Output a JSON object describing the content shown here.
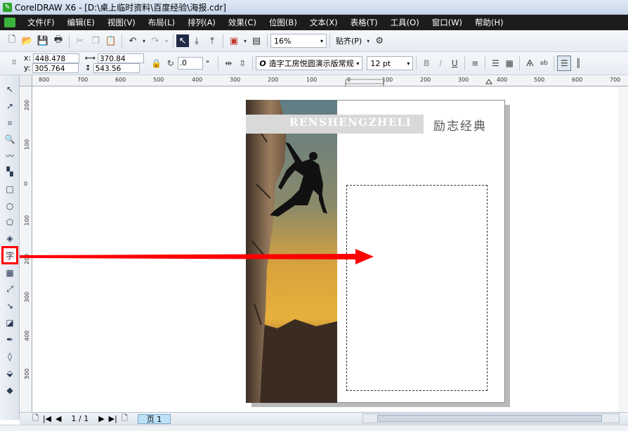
{
  "window": {
    "title": "CorelDRAW X6 - [D:\\桌上临时资料\\百度经验\\海报.cdr]"
  },
  "menu": [
    "文件(F)",
    "编辑(E)",
    "视图(V)",
    "布局(L)",
    "排列(A)",
    "效果(C)",
    "位图(B)",
    "文本(X)",
    "表格(T)",
    "工具(O)",
    "窗口(W)",
    "帮助(H)"
  ],
  "toolbar": {
    "zoom": "16%",
    "snap_label": "贴齐(P)"
  },
  "propbar": {
    "x_label": "x:",
    "x": "448.478 mm",
    "y_label": "y:",
    "y": "305.764 mm",
    "width": "370.84 mm",
    "height": "543.56 mm",
    "rotation": ".0",
    "degree": "°",
    "font_name": "造字工房悦圆演示版常规",
    "font_size": "12 pt",
    "font_icon": "O"
  },
  "ruler_h": [
    "800",
    "700",
    "600",
    "500",
    "400",
    "300",
    "200",
    "100",
    "0",
    "100",
    "200",
    "300",
    "400",
    "500",
    "600",
    "700"
  ],
  "ruler_v": [
    "200",
    "100",
    "0",
    "100",
    "200",
    "300",
    "400",
    "500"
  ],
  "poster": {
    "banner_text": "RENSHENGZHELI",
    "slogan": "励志经典"
  },
  "status": {
    "page_counter": "1 / 1",
    "page_tab": "页 1"
  },
  "colors": {
    "arrow": "#ff0000",
    "menubar": "#1c1c1c",
    "banner": "#d9d9d9"
  },
  "icons": [
    "select-tool-icon",
    "shape-tool-icon",
    "crop-tool-icon",
    "zoom-tool-icon",
    "freehand-tool-icon",
    "smart-fill-icon",
    "rectangle-tool-icon",
    "ellipse-tool-icon",
    "polygon-tool-icon",
    "basic-shapes-icon",
    "text-tool-icon",
    "table-tool-icon",
    "dimension-tool-icon",
    "connector-tool-icon",
    "blend-tool-icon",
    "eyedropper-tool-icon",
    "outline-tool-icon",
    "fill-tool-icon",
    "interactive-fill-icon"
  ]
}
